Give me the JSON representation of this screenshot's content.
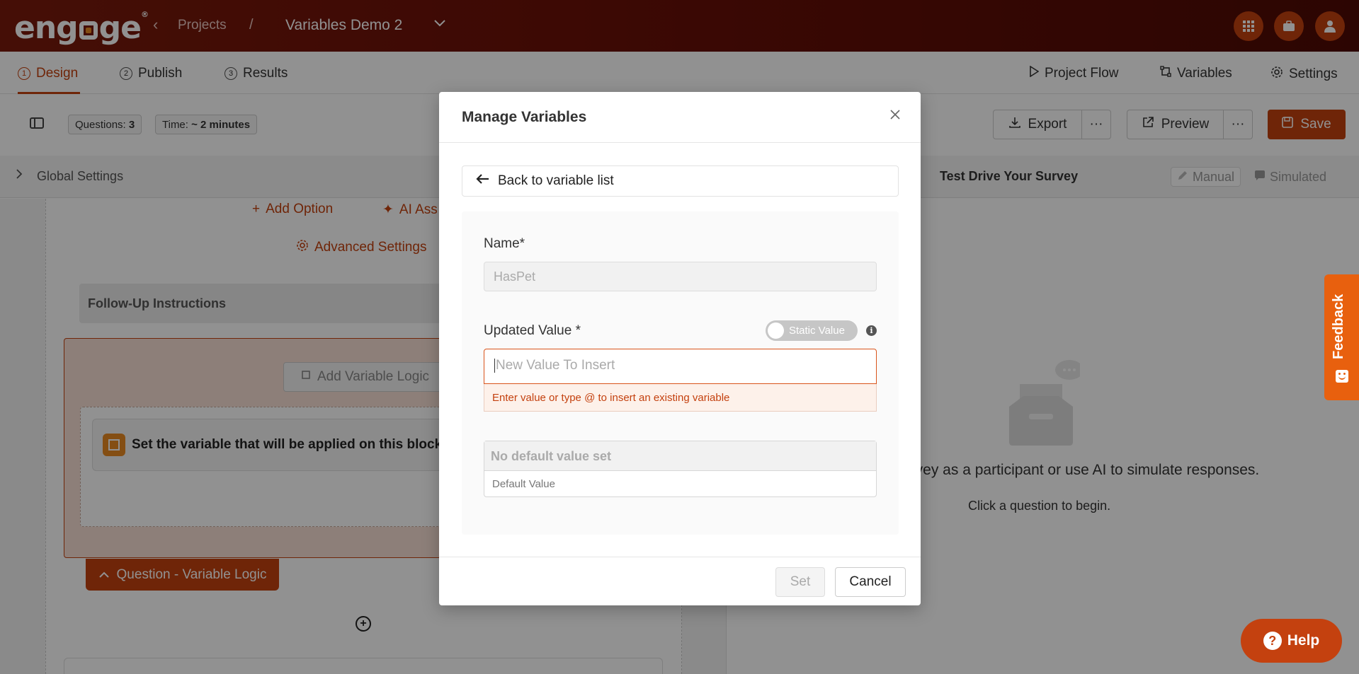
{
  "header": {
    "logo_text": "engage",
    "breadcrumb_projects": "Projects",
    "breadcrumb_separator": "/",
    "project_name": "Variables Demo 2",
    "icons": [
      "apps-grid-icon",
      "briefcase-icon",
      "user-icon"
    ]
  },
  "tabs": [
    {
      "num": "1",
      "label": "Design",
      "active": true
    },
    {
      "num": "2",
      "label": "Publish",
      "active": false
    },
    {
      "num": "3",
      "label": "Results",
      "active": false
    }
  ],
  "right_tabs": {
    "project_flow": "Project Flow",
    "variables": "Variables",
    "settings": "Settings"
  },
  "toolbar": {
    "questions_label": "Questions:",
    "questions_count": "3",
    "time_label": "Time:",
    "time_value": "~ 2 minutes",
    "export": "Export",
    "more": "···",
    "preview": "Preview",
    "save": "Save"
  },
  "global_settings": {
    "label": "Global Settings"
  },
  "editor": {
    "add_option": "Add Option",
    "ai_assist": "AI Ass",
    "advanced_settings": "Advanced Settings",
    "follow_up": "Follow-Up Instructions",
    "add_variable_logic": "Add Variable Logic",
    "variable_card_text": "Set the variable that will be applied on this block/c",
    "question_variable_logic": "Question - Variable Logic"
  },
  "test_drive": {
    "title": "Test Drive Your Survey",
    "mode_manual": "Manual",
    "mode_simulated": "Simulated",
    "main_text": "urvey as a participant or use AI to simulate responses.",
    "sub_text": "Click a question to begin."
  },
  "feedback_label": "Feedback",
  "help_label": "Help",
  "modal": {
    "title": "Manage Variables",
    "back_label": "Back to variable list",
    "name_label": "Name*",
    "name_value": "HasPet",
    "updated_value_label": "Updated Value *",
    "toggle_label": "Static Value",
    "toggle_on": false,
    "value_placeholder": "New Value To Insert",
    "value_hint": "Enter value or type @ to insert an existing variable",
    "default_display": "No default value set",
    "default_label": "Default Value",
    "set": "Set",
    "cancel": "Cancel"
  },
  "colors": {
    "brand": "#c4410f",
    "header_dark": "#6a1008",
    "feedback": "#e8600e"
  }
}
